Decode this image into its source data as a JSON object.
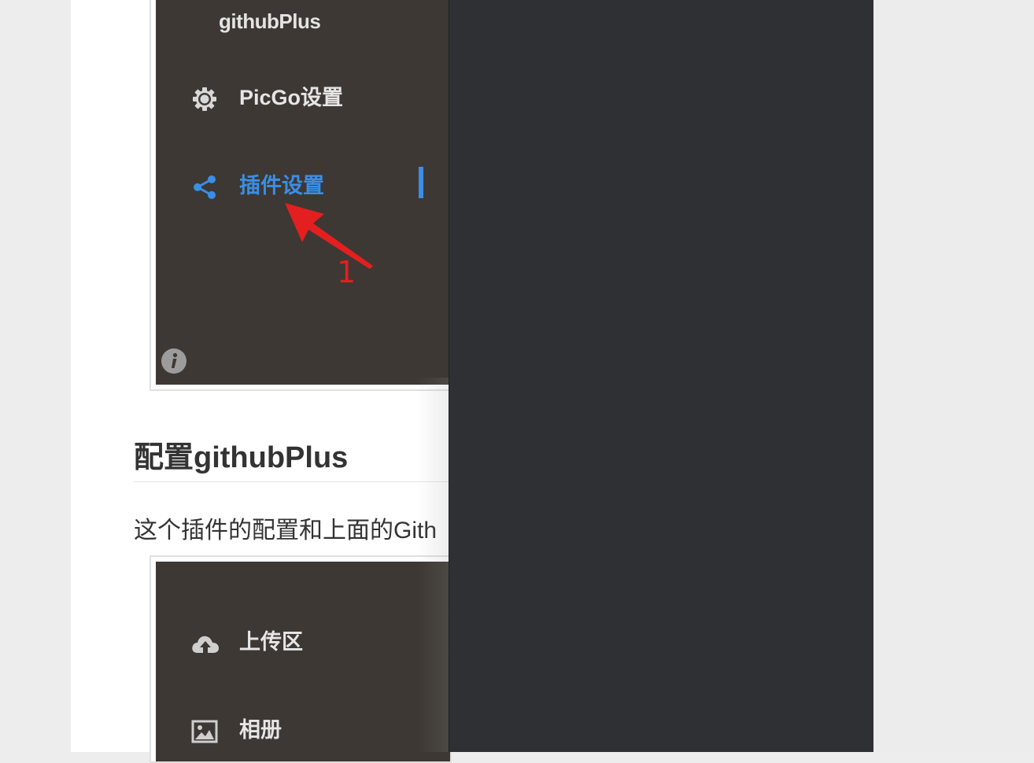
{
  "screenshot1": {
    "title": "githubPlus",
    "menu": [
      {
        "label": "PicGo设置",
        "icon": "gear-icon"
      },
      {
        "label": "插件设置",
        "icon": "share-icon",
        "active": true
      }
    ],
    "annotation_number": "1",
    "info_icon": "info-icon"
  },
  "article": {
    "heading": "配置githubPlus",
    "paragraph": "这个插件的配置和上面的Gith"
  },
  "screenshot2": {
    "menu": [
      {
        "label": "上传区",
        "icon": "cloud-upload-icon"
      },
      {
        "label": "相册",
        "icon": "image-icon"
      }
    ]
  },
  "colors": {
    "app_sidebar_bg": "#3d3833",
    "active_blue": "#3a8ee6",
    "annotation_red": "#e31f1f",
    "overlay_panel": "#2f3034"
  }
}
